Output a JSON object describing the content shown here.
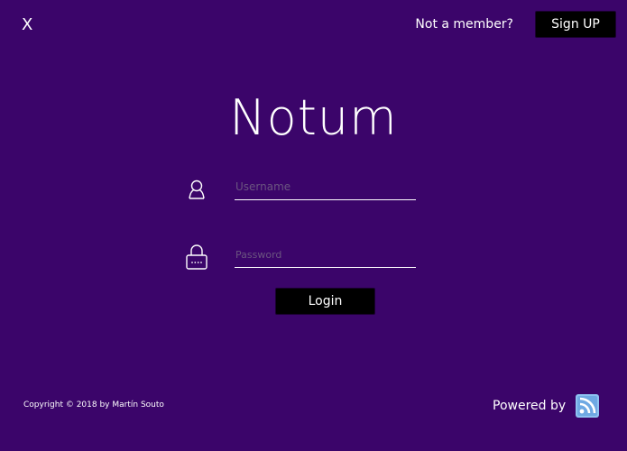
{
  "header": {
    "close_label": "X",
    "not_member_text": "Not a member?",
    "signup_label": "Sign UP"
  },
  "brand": {
    "title": "Notum"
  },
  "form": {
    "username_placeholder": "Username",
    "password_placeholder": "Password",
    "login_label": "Login",
    "username_icon": "user-icon",
    "password_icon": "lock-icon"
  },
  "footer": {
    "copyright": "Copyright © 2018 by Martín Souto",
    "powered_by": "Powered by",
    "feed_icon": "rss-icon"
  },
  "colors": {
    "background": "#3b056a",
    "button": "#000000",
    "text": "#ffffff",
    "rss_icon": "#8ec2f1"
  }
}
